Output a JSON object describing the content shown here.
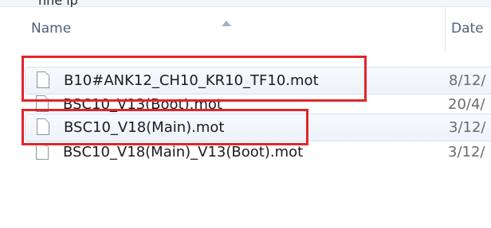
{
  "header": {
    "cut_text": "nne ip",
    "name_label": "Name",
    "date_label": "Date"
  },
  "files": [
    {
      "name": "B10#ANK12_CH10_KR10_TF10.mot",
      "date": "8/12/",
      "selected": true,
      "highlighted": true
    },
    {
      "name": "BSC10_V13(Boot).mot",
      "date": "20/4/",
      "selected": false,
      "highlighted": false
    },
    {
      "name": "BSC10_V18(Main).mot",
      "date": "3/12/",
      "selected": true,
      "highlighted": true
    },
    {
      "name": "BSC10_V18(Main)_V13(Boot).mot",
      "date": "3/12/",
      "selected": false,
      "highlighted": false
    }
  ],
  "colors": {
    "highlight_box": "#e3242b",
    "selection": "#eef3fa"
  }
}
